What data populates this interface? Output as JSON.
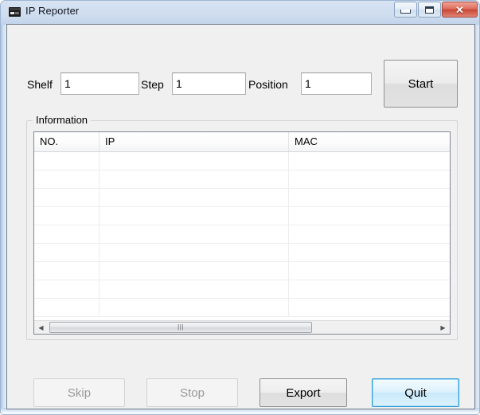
{
  "window": {
    "title": "IP Reporter",
    "icon": "app-device-icon",
    "controls": {
      "minimize": "minimize-icon",
      "maximize": "maximize-icon",
      "close": "✕"
    }
  },
  "form": {
    "shelf": {
      "label": "Shelf",
      "value": "1"
    },
    "step": {
      "label": "Step",
      "value": "1"
    },
    "position": {
      "label": "Position",
      "value": "1"
    },
    "start_button": "Start"
  },
  "information": {
    "legend": "Information",
    "columns": [
      "NO.",
      "IP",
      "MAC"
    ],
    "rows": [
      [
        "",
        "",
        ""
      ],
      [
        "",
        "",
        ""
      ],
      [
        "",
        "",
        ""
      ],
      [
        "",
        "",
        ""
      ],
      [
        "",
        "",
        ""
      ],
      [
        "",
        "",
        ""
      ],
      [
        "",
        "",
        ""
      ],
      [
        "",
        "",
        ""
      ],
      [
        "",
        "",
        ""
      ]
    ],
    "scrollbar": {
      "left_arrow": "◀",
      "right_arrow": "▶",
      "grip": "|||"
    }
  },
  "actions": {
    "skip": "Skip",
    "stop": "Stop",
    "export": "Export",
    "quit": "Quit"
  },
  "colors": {
    "titlebar": "#cfddf0",
    "close_button": "#c94836",
    "default_button_border": "#2e9bd6",
    "client_background": "#f0f0f0"
  }
}
